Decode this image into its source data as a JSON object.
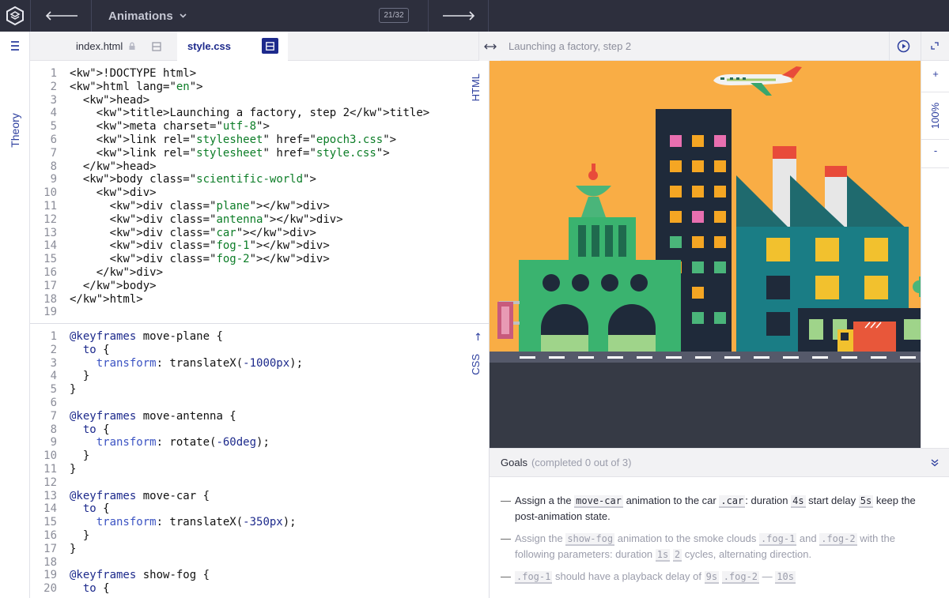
{
  "topbar": {
    "course_title": "Animations",
    "progress": "21/32",
    "logo_icon": "htmlacademy-logo-icon",
    "back_icon": "arrow-left-icon",
    "next_icon": "arrow-right-icon",
    "course_dropdown_icon": "chevron-down-icon"
  },
  "sidebar": {
    "theory_label": "Theory",
    "menu_icon": "hamburger-menu-icon"
  },
  "editor": {
    "tabs": [
      {
        "label": "index.html",
        "active": false,
        "locked": true
      },
      {
        "label": "style.css",
        "active": true,
        "locked": false
      }
    ],
    "html_label": "HTML",
    "css_label": "CSS",
    "html_lines": [
      "<!DOCTYPE html>",
      "<html lang=\"en\">",
      "  <head>",
      "    <title>Launching a factory, step 2</title>",
      "    <meta charset=\"utf-8\">",
      "    <link rel=\"stylesheet\" href=\"epoch3.css\">",
      "    <link rel=\"stylesheet\" href=\"style.css\">",
      "  </head>",
      "  <body class=\"scientific-world\">",
      "    <div>",
      "      <div class=\"plane\"></div>",
      "      <div class=\"antenna\"></div>",
      "      <div class=\"car\"></div>",
      "      <div class=\"fog-1\"></div>",
      "      <div class=\"fog-2\"></div>",
      "    </div>",
      "  </body>",
      "</html>",
      ""
    ],
    "css_lines": [
      "@keyframes move-plane {",
      "  to {",
      "    transform: translateX(-1000px);",
      "  }",
      "}",
      "",
      "@keyframes move-antenna {",
      "  to {",
      "    transform: rotate(-60deg);",
      "  }",
      "}",
      "",
      "@keyframes move-car {",
      "  to {",
      "    transform: translateX(-350px);",
      "  }",
      "}",
      "",
      "@keyframes show-fog {",
      "  to {"
    ]
  },
  "preview": {
    "title": "Launching a factory, step 2",
    "zoom": "100%",
    "zoom_in": "+",
    "zoom_out": "-",
    "resize_icon": "horizontal-arrows-icon",
    "play_icon": "play-circle-icon",
    "expand_icon": "expand-icon"
  },
  "goals": {
    "title": "Goals",
    "status": "(completed 0 out of 3)",
    "collapse_icon": "double-chevron-down-icon",
    "items": [
      {
        "parts": [
          "Assign a the ",
          "move-car",
          " animation to the car ",
          ".car",
          ": duration ",
          "4s",
          "  start delay ",
          "5s",
          "  keep the post-animation state."
        ]
      },
      {
        "parts": [
          "Assign the ",
          "show-fog",
          " animation to the smoke clouds ",
          ".fog-1",
          " and ",
          ".fog-2",
          " with the following parameters: duration ",
          "1s",
          " ",
          "2",
          " cycles, alternating direction."
        ]
      },
      {
        "parts": [
          "",
          ".fog-1",
          " should have a playback delay of ",
          "9s",
          " ",
          ".fog-2",
          " — ",
          "10s",
          ""
        ]
      }
    ]
  },
  "colors": {
    "topbar": "#2d2f3d",
    "accent": "#1d2a8c",
    "sky": "#f9ad45",
    "road": "#363a45"
  }
}
